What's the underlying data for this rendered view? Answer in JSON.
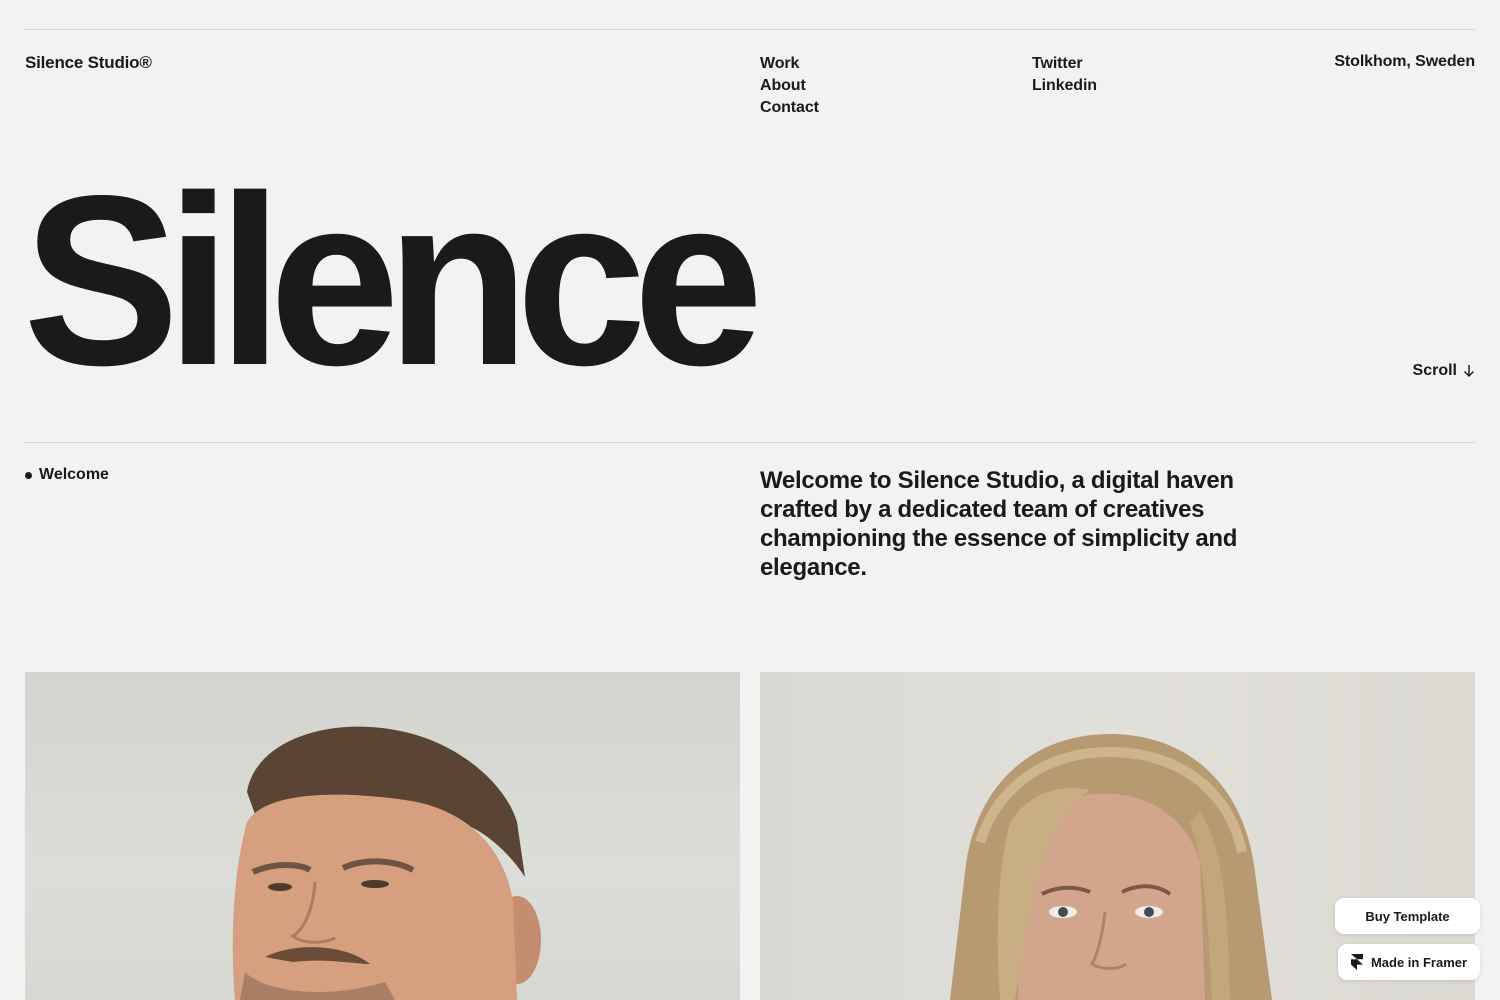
{
  "header": {
    "brand": "Silence Studio®",
    "nav": [
      "Work",
      "About",
      "Contact"
    ],
    "social": [
      "Twitter",
      "Linkedin"
    ],
    "location": "Stolkhom, Sweden"
  },
  "hero": {
    "word": "Silence",
    "scroll_label": "Scroll",
    "scroll_icon": "arrow-down-icon"
  },
  "welcome": {
    "label": "Welcome",
    "text": "Welcome to Silence Studio, a digital haven crafted by a dedicated team of creatives championing the essence of simplicity and elegance."
  },
  "photos": [
    {
      "subject": "man-portrait"
    },
    {
      "subject": "woman-portrait"
    }
  ],
  "badges": {
    "buy": "Buy Template",
    "framer": "Made in Framer",
    "framer_icon": "framer-logo-icon"
  },
  "colors": {
    "background": "#f2f2f2",
    "text": "#1a1a1a",
    "rule": "#d6d6d6"
  }
}
